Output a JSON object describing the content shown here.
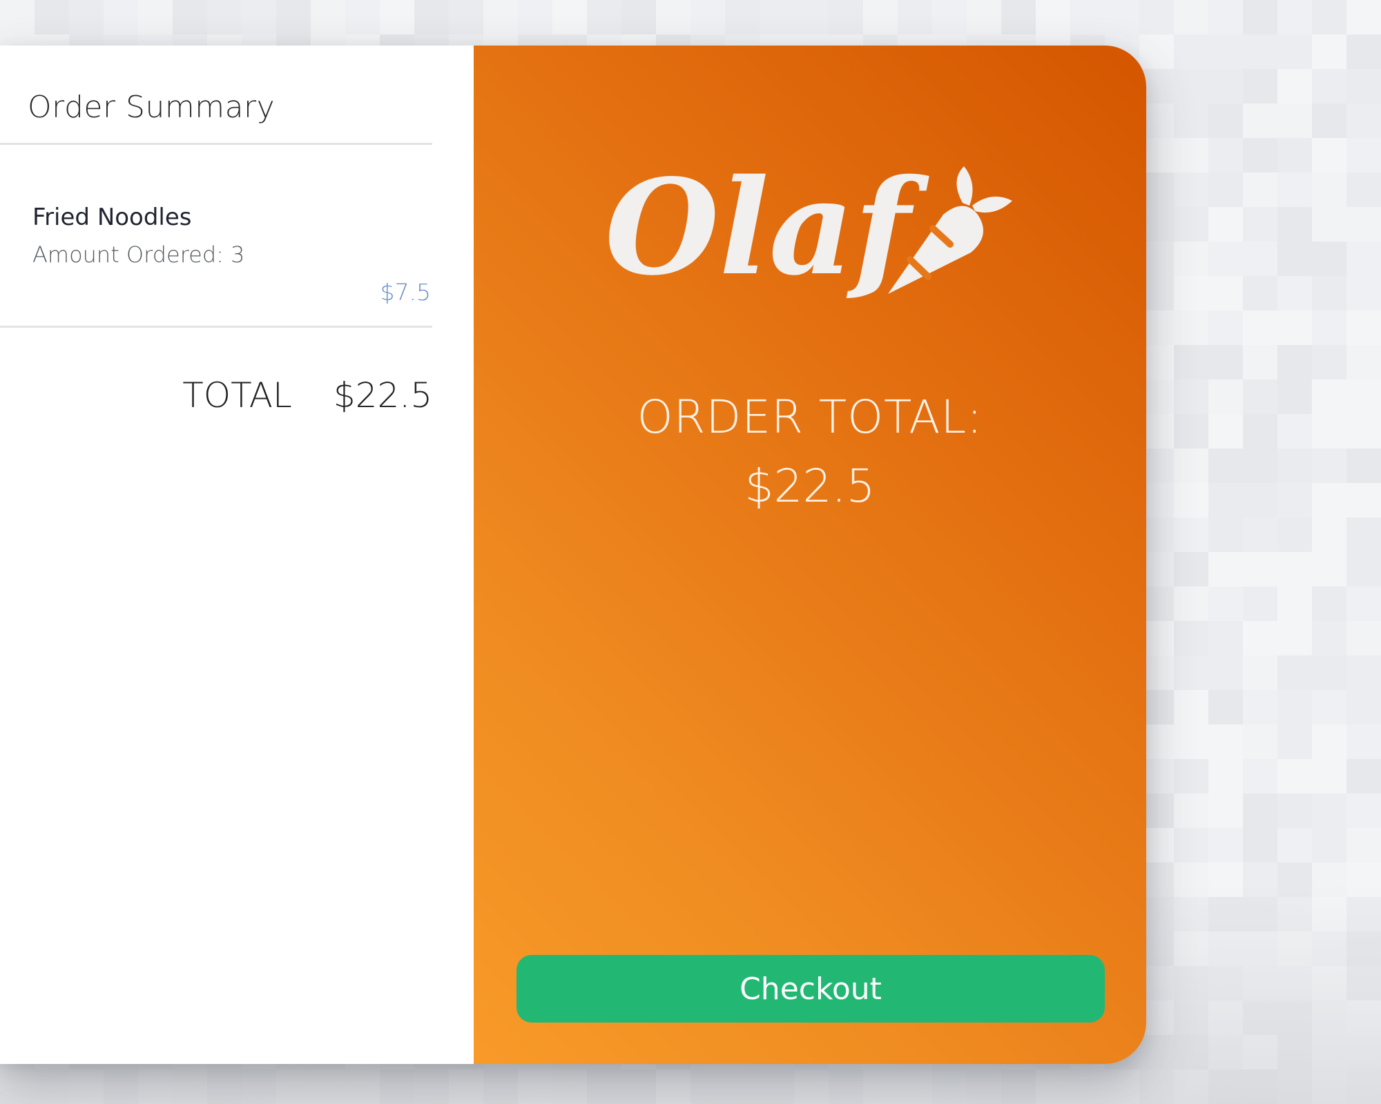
{
  "summary": {
    "title": "Order Summary",
    "items": [
      {
        "name": "Fried Noodles",
        "qty_label": "Amount Ordered:",
        "qty_value": "3",
        "price": "$7.5"
      }
    ],
    "total_label": "TOTAL",
    "total_value": "$22.5"
  },
  "brand": {
    "logo_text": "Olaf",
    "logo_icon": "carrot-icon",
    "order_total_label": "ORDER TOTAL:",
    "order_total_value": "$22.5",
    "checkout_label": "Checkout"
  },
  "colors": {
    "accent_orange": "#e36f10",
    "checkout_green": "#22b874",
    "price_blue": "#6c8fc7"
  }
}
